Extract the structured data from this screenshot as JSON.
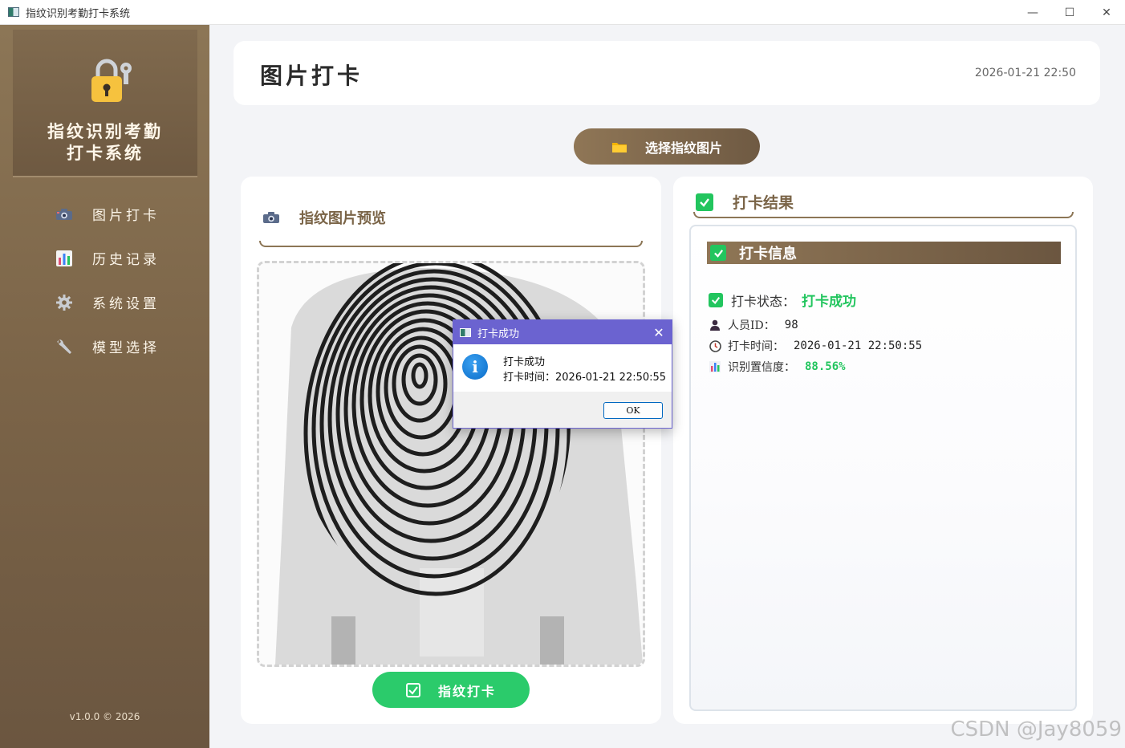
{
  "window": {
    "title": "指纹识别考勤打卡系统",
    "controls": [
      "—",
      "☐",
      "✕"
    ]
  },
  "sidebar": {
    "brand_line1": "指纹识别考勤",
    "brand_line2": "打卡系统",
    "brand_icon": "padlock-key-icon",
    "items": [
      {
        "label": "图片打卡",
        "icon": "camera-icon"
      },
      {
        "label": "历史记录",
        "icon": "bar-chart-icon"
      },
      {
        "label": "系统设置",
        "icon": "gear-icon"
      },
      {
        "label": "模型选择",
        "icon": "wrench-icon"
      }
    ],
    "version": "v1.0.0 © 2026"
  },
  "header": {
    "title": "图片打卡",
    "datetime": "2026-01-21 22:50"
  },
  "actions": {
    "choose_label": "选择指纹图片",
    "punch_label": "指纹打卡"
  },
  "preview": {
    "title": "指纹图片预览"
  },
  "result": {
    "title": "打卡结果",
    "info_title": "打卡信息",
    "status_label": "打卡状态：",
    "status_value": "打卡成功",
    "person_label": "人员ID：",
    "person_value": "98",
    "time_label": "打卡时间：",
    "time_value": "2026-01-21 22:50:55",
    "conf_label": "识别置信度：",
    "conf_value": "88.56%"
  },
  "dialog": {
    "title": "打卡成功",
    "line1": "打卡成功",
    "line2": "打卡时间：2026-01-21 22:50:55",
    "ok_label": "OK"
  },
  "watermark": "CSDN @Jay8059",
  "colors": {
    "accent_brown": "#8c7656",
    "success_green": "#22c55e",
    "dialog_purple": "#6b63d0"
  }
}
